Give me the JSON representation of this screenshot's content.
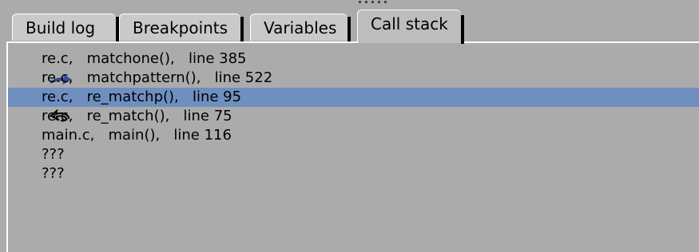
{
  "tabs": [
    {
      "label": "Build log",
      "active": false
    },
    {
      "label": "Breakpoints",
      "active": false
    },
    {
      "label": "Variables",
      "active": false
    },
    {
      "label": "Call stack",
      "active": true
    }
  ],
  "call_stack": [
    {
      "text": "re.c,   matchone(),   line 385",
      "marker": "current-frame-arrow-icon",
      "selected": false
    },
    {
      "text": "re.c,   matchpattern(),   line 522",
      "marker": "",
      "selected": false
    },
    {
      "text": "re.c,   re_matchp(),   line 95",
      "marker": "return-arrow-icon",
      "selected": true
    },
    {
      "text": "re.c,   re_match(),   line 75",
      "marker": "",
      "selected": false
    },
    {
      "text": "main.c,   main(),   line 116",
      "marker": "",
      "selected": false
    },
    {
      "text": "???",
      "marker": "",
      "selected": false
    },
    {
      "text": "???",
      "marker": "",
      "selected": false
    }
  ],
  "colors": {
    "background": "#ababab",
    "selection": "#6f8fc0",
    "tab_background": "#c9c9c9",
    "arrow": "#3a4fa8"
  }
}
